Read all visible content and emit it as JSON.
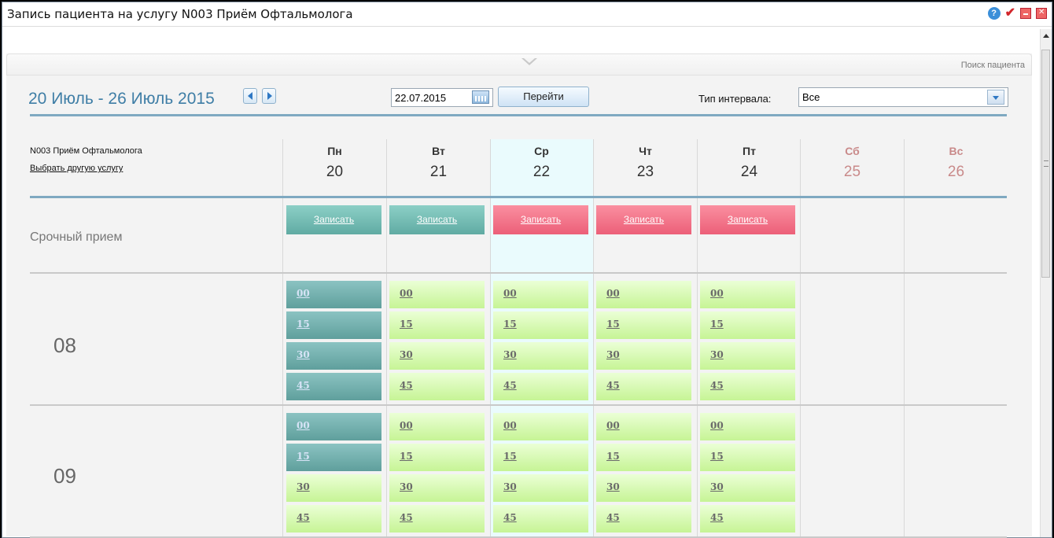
{
  "window": {
    "title": "Запись пациента на услугу N003 Приём Офтальмолога"
  },
  "toolbar": {
    "search_patient": "Поиск пациента"
  },
  "nav": {
    "week_label": "20 Июль - 26 Июль 2015",
    "date_value": "22.07.2015",
    "go_label": "Перейти"
  },
  "interval": {
    "label": "Тип интервала:",
    "value": "Все"
  },
  "service": {
    "name": "N003 Приём Офтальмолога",
    "change_link": "Выбрать другую услугу"
  },
  "days": [
    {
      "name": "Пн",
      "num": "20"
    },
    {
      "name": "Вт",
      "num": "21"
    },
    {
      "name": "Ср",
      "num": "22"
    },
    {
      "name": "Чт",
      "num": "23"
    },
    {
      "name": "Пт",
      "num": "24"
    },
    {
      "name": "Сб",
      "num": "25"
    },
    {
      "name": "Вс",
      "num": "26"
    }
  ],
  "urgent": {
    "label": "Срочный прием",
    "book_label": "Записать"
  },
  "hours": [
    {
      "label": "08",
      "slots": [
        "00",
        "15",
        "30",
        "45"
      ]
    },
    {
      "label": "09",
      "slots": [
        "00",
        "15",
        "30",
        "45"
      ]
    }
  ],
  "colors": {
    "accent": "#3f7ea6",
    "urgent_teal": "#60aba3",
    "urgent_pink": "#ec5f78",
    "slot_green": "#c6f495",
    "slot_teal": "#5f9f9c",
    "weekend": "#c98a8a"
  }
}
